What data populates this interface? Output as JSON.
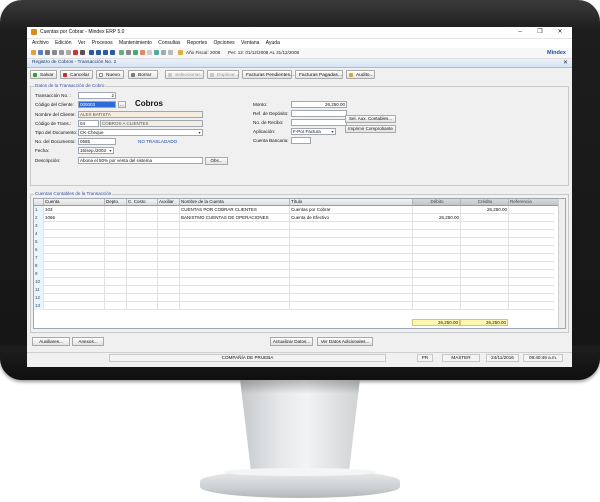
{
  "window": {
    "title": "Cuentas por Cobrar - Mindex ERP 5.0",
    "minimize": "–",
    "restore": "❐",
    "close": "✕"
  },
  "menu": [
    "Archivo",
    "Edición",
    "Ver",
    "Procesos",
    "Mantenimiento",
    "Consultas",
    "Reportes",
    "Opciones",
    "Ventana",
    "Ayuda"
  ],
  "toolbar": {
    "fiscal_year": "Año Fiscal: 2008",
    "period": "Per: 12: 01/12/2008 AL 31/12/2008",
    "brand": "Mindex"
  },
  "document": {
    "tab_title": "Registro de Cobros - Transacción No. 2",
    "close": "✕"
  },
  "actions": {
    "save": "Salvar",
    "cancel": "Cancelar",
    "new": "Nuevo",
    "delete": "Borrar",
    "select": "Seleccionar...",
    "duplicate": "Duplicar...",
    "pending_invoices": "Facturas Pendientes...",
    "paid_invoices": "Facturas Pagadas...",
    "audit": "Audito..."
  },
  "transaction": {
    "legend": "Datos de la Transacción de Cobro",
    "form_title": "Cobros",
    "labels": {
      "trans_no": "Transacción No. :",
      "client_code": "Código del Cliente:",
      "client_name": "Nombre del Cliente:",
      "trans_code": "Código de Trans.:",
      "doc_type": "Tipo del Documento:",
      "doc_no": "No. del Documento:",
      "date": "Fecha:",
      "description": "Descripción:",
      "amount": "Monto:",
      "deposit_ref": "Ref. de Depósito:",
      "receipt_no": "No. de Recibo:",
      "application": "Aplicación:",
      "bank_account": "Cuenta Bancaria:"
    },
    "values": {
      "trans_no": "2",
      "client_code": "000003",
      "client_name": "ALEX BATISTA",
      "trans_code": "04",
      "trans_code_desc": "COBROS A CLIENTES",
      "doc_type": "CK-Cheque",
      "doc_no": "0585",
      "status": "NO TRASLADADO",
      "date": "16/sep./2003",
      "description": "Abona el 50% por venta del sistema",
      "amount": "26,250.00",
      "deposit_ref": "",
      "receipt_no": "",
      "application": "F-Por Factura",
      "bank_account": ""
    },
    "buttons": {
      "client_lookup": "...",
      "obs": "Obs...",
      "sel_aux": "Sel. Aux. Contables...",
      "print_receipt": "Imprimir Comprobante"
    }
  },
  "accounts": {
    "legend": "Cuentas Contables de la Transacción",
    "columns": [
      "",
      "Cuenta",
      "Depto.",
      "C. Costo",
      "Auxiliar",
      "Nombre de la Cuenta",
      "Título",
      "Débito",
      "Crédito",
      "Referencia"
    ],
    "rows": [
      {
        "n": "1",
        "cuenta": "103",
        "depto": "",
        "ccosto": "",
        "aux": "",
        "nombre": "CUENTAS POR COBRAR CLIENTES",
        "titulo": "Cuentas por Cobrar",
        "debito": "",
        "credito": "26,250.00",
        "ref": ""
      },
      {
        "n": "2",
        "cuenta": "1066",
        "depto": "",
        "ccosto": "",
        "aux": "",
        "nombre": "BANISTMO CUENTAS DE OPERACIONES",
        "titulo": "Cuenta de Efectivo",
        "debito": "26,250.00",
        "credito": "",
        "ref": ""
      },
      {
        "n": "3",
        "cuenta": "",
        "depto": "",
        "ccosto": "",
        "aux": "",
        "nombre": "",
        "titulo": "",
        "debito": "",
        "credito": "",
        "ref": ""
      },
      {
        "n": "4",
        "cuenta": "",
        "depto": "",
        "ccosto": "",
        "aux": "",
        "nombre": "",
        "titulo": "",
        "debito": "",
        "credito": "",
        "ref": ""
      },
      {
        "n": "5",
        "cuenta": "",
        "depto": "",
        "ccosto": "",
        "aux": "",
        "nombre": "",
        "titulo": "",
        "debito": "",
        "credito": "",
        "ref": ""
      },
      {
        "n": "6",
        "cuenta": "",
        "depto": "",
        "ccosto": "",
        "aux": "",
        "nombre": "",
        "titulo": "",
        "debito": "",
        "credito": "",
        "ref": ""
      },
      {
        "n": "7",
        "cuenta": "",
        "depto": "",
        "ccosto": "",
        "aux": "",
        "nombre": "",
        "titulo": "",
        "debito": "",
        "credito": "",
        "ref": ""
      },
      {
        "n": "8",
        "cuenta": "",
        "depto": "",
        "ccosto": "",
        "aux": "",
        "nombre": "",
        "titulo": "",
        "debito": "",
        "credito": "",
        "ref": ""
      },
      {
        "n": "9",
        "cuenta": "",
        "depto": "",
        "ccosto": "",
        "aux": "",
        "nombre": "",
        "titulo": "",
        "debito": "",
        "credito": "",
        "ref": ""
      },
      {
        "n": "10",
        "cuenta": "",
        "depto": "",
        "ccosto": "",
        "aux": "",
        "nombre": "",
        "titulo": "",
        "debito": "",
        "credito": "",
        "ref": ""
      },
      {
        "n": "11",
        "cuenta": "",
        "depto": "",
        "ccosto": "",
        "aux": "",
        "nombre": "",
        "titulo": "",
        "debito": "",
        "credito": "",
        "ref": ""
      },
      {
        "n": "12",
        "cuenta": "",
        "depto": "",
        "ccosto": "",
        "aux": "",
        "nombre": "",
        "titulo": "",
        "debito": "",
        "credito": "",
        "ref": ""
      },
      {
        "n": "13",
        "cuenta": "",
        "depto": "",
        "ccosto": "",
        "aux": "",
        "nombre": "",
        "titulo": "",
        "debito": "",
        "credito": "",
        "ref": ""
      }
    ],
    "total_debit": "26,250.00",
    "total_credit": "26,250.00"
  },
  "bottom_buttons": {
    "auxiliares": "Auxiliares...",
    "anexos": "Anexos...",
    "update": "Actualizar Datos...",
    "more": "Ver Datos Adicionales..."
  },
  "status": {
    "company": "COMPAÑÍA DE PRUEBA",
    "mode": "PR",
    "user": "MASTER",
    "date": "24/11/2016",
    "time": "09:40:49 a.m."
  }
}
